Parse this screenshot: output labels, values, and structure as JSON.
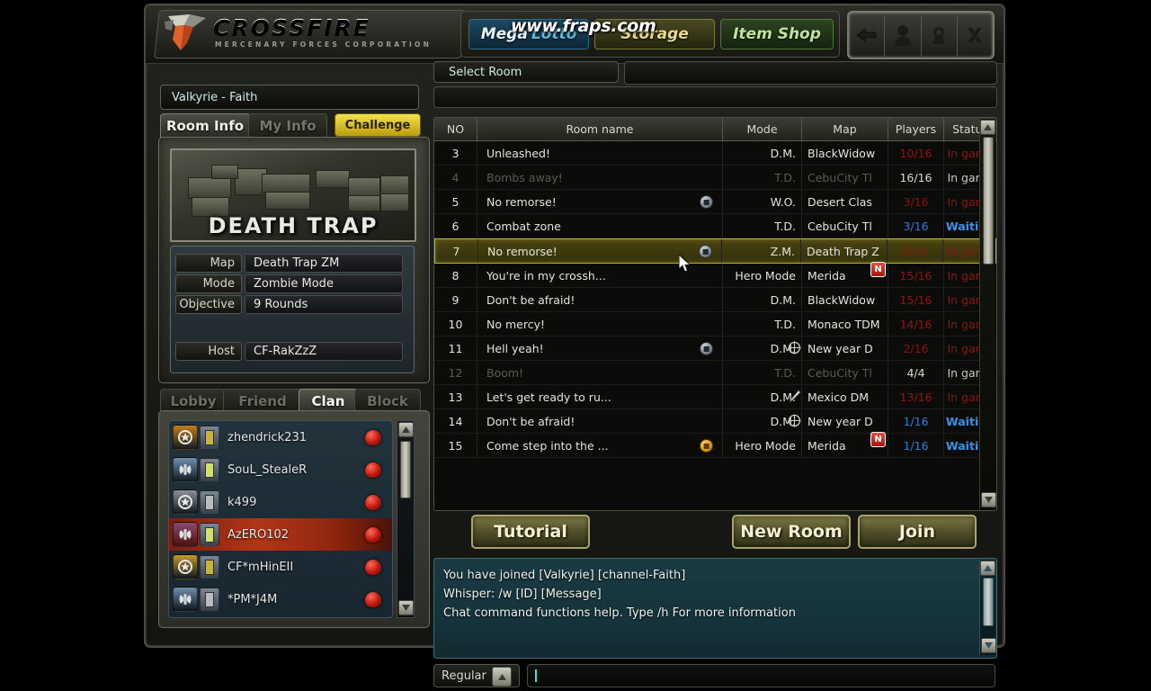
{
  "header": {
    "logo_text": "CROSSFIRE",
    "logo_sub": "MERCENARY FORCES CORPORATION",
    "watermark": "www.fraps.com",
    "nav": [
      {
        "name": "mega-lotto",
        "word1": "Mega",
        "word2": "Lotto"
      },
      {
        "name": "storage",
        "label": "Storage"
      },
      {
        "name": "item-shop",
        "label": "Item Shop"
      }
    ],
    "window_controls": [
      {
        "name": "back-arrow-icon"
      },
      {
        "name": "profile-icon"
      },
      {
        "name": "settings-icon"
      },
      {
        "name": "close-icon"
      }
    ]
  },
  "sidebar": {
    "channel": "Valkyrie - Faith",
    "tabs": [
      {
        "label": "Room Info",
        "active": true
      },
      {
        "label": "My Info",
        "active": false
      }
    ],
    "challenge_label": "Challenge",
    "map_title": "DEATH TRAP",
    "info_rows": [
      {
        "key": "Map",
        "value": "Death Trap ZM"
      },
      {
        "key": "Mode",
        "value": "Zombie Mode"
      },
      {
        "key": "Objective",
        "value": "9 Rounds"
      },
      {
        "key": "Host",
        "value": "CF-RakZzZ"
      }
    ],
    "list_tabs": [
      {
        "label": "Lobby",
        "active": false
      },
      {
        "label": "Friend",
        "active": false
      },
      {
        "label": "Clan",
        "active": true
      },
      {
        "label": "Block",
        "active": false
      }
    ],
    "clan_members": [
      {
        "name": "zhendrick231",
        "rank_color": "#c47f1d",
        "selected": false
      },
      {
        "name": "SouL_StealeR",
        "rank_color": "#6f8fae",
        "selected": false
      },
      {
        "name": "k499",
        "rank_color": "#8e9298",
        "selected": false
      },
      {
        "name": "AzERO102",
        "rank_color": "#8a4a72",
        "selected": true
      },
      {
        "name": "CF*mHinEII",
        "rank_color": "#c49a2a",
        "selected": false
      },
      {
        "name": "*PM*J4M",
        "rank_color": "#6f8fae",
        "selected": false
      }
    ]
  },
  "room_list": {
    "select_room_label": "Select Room",
    "columns": [
      "NO",
      "Room name",
      "Mode",
      "Map",
      "Players",
      "Status"
    ],
    "rows": [
      {
        "no": "3",
        "name": "Unleashed!",
        "mode": "D.M.",
        "map": "BlackWidow",
        "players": "10/16",
        "status": "In game",
        "state": "ingame",
        "dim": false,
        "lock": "",
        "badge": "",
        "mode_icon": ""
      },
      {
        "no": "4",
        "name": "Bombs away!",
        "mode": "T.D.",
        "map": "CebuCity Tl",
        "players": "16/16",
        "status": "In game",
        "state": "normal",
        "dim": true,
        "lock": "",
        "badge": "",
        "mode_icon": ""
      },
      {
        "no": "5",
        "name": "No remorse!",
        "mode": "W.O.",
        "map": "Desert Clas",
        "players": "3/16",
        "status": "In game",
        "state": "ingame",
        "dim": false,
        "lock": "blue",
        "badge": "",
        "mode_icon": ""
      },
      {
        "no": "6",
        "name": "Combat zone",
        "mode": "T.D.",
        "map": "CebuCity Tl",
        "players": "3/16",
        "status": "Waiting",
        "state": "waiting",
        "dim": false,
        "lock": "",
        "badge": "",
        "mode_icon": ""
      },
      {
        "no": "7",
        "name": "No remorse!",
        "mode": "Z.M.",
        "map": "Death Trap Z",
        "players": "6/16",
        "status": "In game",
        "state": "ingame",
        "dim": false,
        "lock": "blue",
        "badge": "",
        "mode_icon": "",
        "selected": true
      },
      {
        "no": "8",
        "name": "You're in my crossh...",
        "mode": "Hero Mode",
        "map": "Merida",
        "players": "15/16",
        "status": "In game",
        "state": "ingame",
        "dim": false,
        "lock": "",
        "badge": "N",
        "mode_icon": ""
      },
      {
        "no": "9",
        "name": "Don't be afraid!",
        "mode": "D.M.",
        "map": "BlackWidow",
        "players": "15/16",
        "status": "In game",
        "state": "ingame",
        "dim": false,
        "lock": "",
        "badge": "",
        "mode_icon": ""
      },
      {
        "no": "10",
        "name": "No mercy!",
        "mode": "T.D.",
        "map": "Monaco TDM",
        "players": "14/16",
        "status": "In game",
        "state": "ingame",
        "dim": false,
        "lock": "",
        "badge": "",
        "mode_icon": ""
      },
      {
        "no": "11",
        "name": "Hell yeah!",
        "mode": "D.M.",
        "map": "New year D",
        "players": "2/16",
        "status": "In game",
        "state": "ingame",
        "dim": false,
        "lock": "blue",
        "badge": "",
        "mode_icon": "crosshair"
      },
      {
        "no": "12",
        "name": "Boom!",
        "mode": "T.D.",
        "map": "CebuCity Tl",
        "players": "4/4",
        "status": "In game",
        "state": "normal",
        "dim": true,
        "lock": "",
        "badge": "",
        "mode_icon": ""
      },
      {
        "no": "13",
        "name": "Let's get ready to ru...",
        "mode": "D.M.",
        "map": "Mexico DM",
        "players": "13/16",
        "status": "In game",
        "state": "ingame",
        "dim": false,
        "lock": "",
        "badge": "",
        "mode_icon": "knife"
      },
      {
        "no": "14",
        "name": "Don't be afraid!",
        "mode": "D.M.",
        "map": "New year D",
        "players": "1/16",
        "status": "Waiting",
        "state": "waiting",
        "dim": false,
        "lock": "",
        "badge": "",
        "mode_icon": "crosshair"
      },
      {
        "no": "15",
        "name": "Come step into the ...",
        "mode": "Hero Mode",
        "map": "Merida",
        "players": "1/16",
        "status": "Waiting",
        "state": "waiting",
        "dim": false,
        "lock": "orange",
        "badge": "N",
        "mode_icon": ""
      }
    ]
  },
  "actions": {
    "tutorial": "Tutorial",
    "new_room": "New Room",
    "join": "Join"
  },
  "chat": {
    "lines": [
      "You have joined [Valkyrie] [channel-Faith]",
      "Whisper: /w [ID] [Message]",
      "Chat command functions help. Type /h For more information"
    ],
    "mode_label": "Regular",
    "input_value": ""
  },
  "colors": {
    "accent_gold": "#b9ad35",
    "in_game": "#8a1512",
    "waiting": "#3a93e8",
    "challenge": "#f3e24b"
  }
}
